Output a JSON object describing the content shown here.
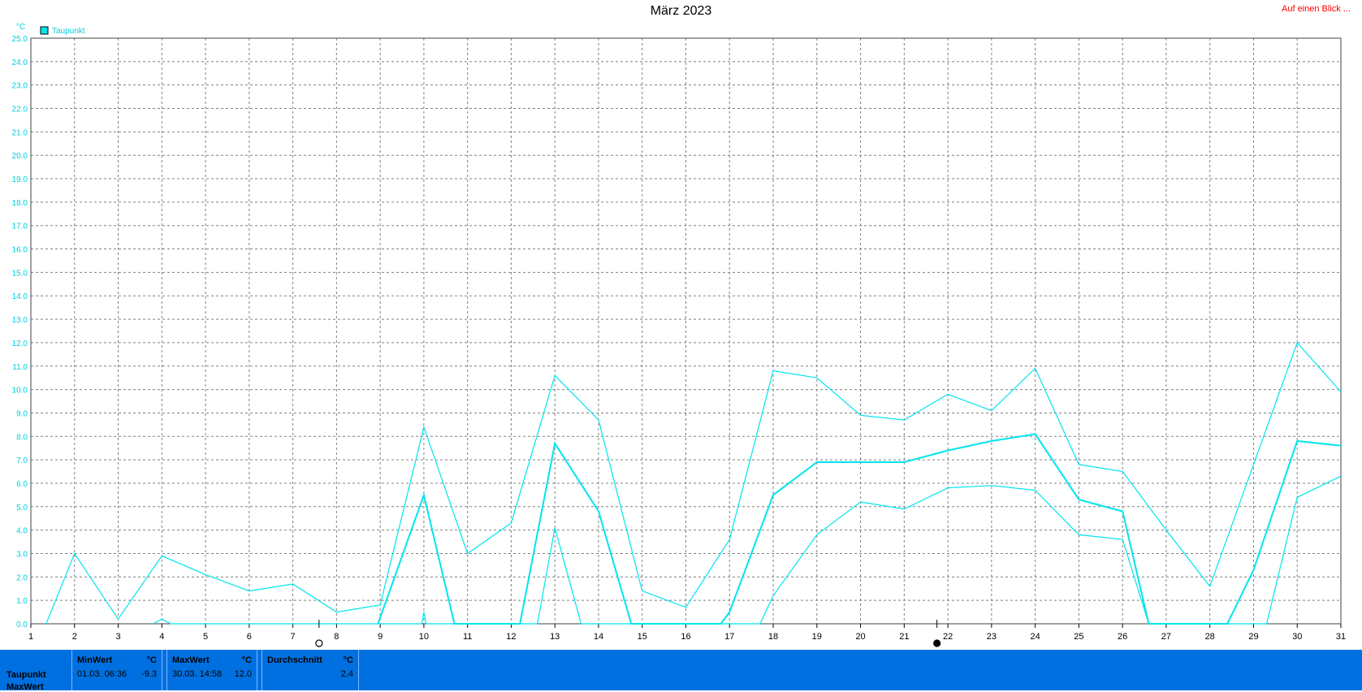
{
  "title": "März 2023",
  "top_link": "Auf einen Blick ...",
  "chart_data": {
    "type": "line",
    "title": "März 2023",
    "ylabel": "°C",
    "ylim": [
      0,
      25
    ],
    "yticks": [
      "0.0",
      "1.0",
      "2.0",
      "3.0",
      "4.0",
      "5.0",
      "6.0",
      "7.0",
      "8.0",
      "9.0",
      "10.0",
      "11.0",
      "12.0",
      "13.0",
      "14.0",
      "15.0",
      "16.0",
      "17.0",
      "18.0",
      "19.0",
      "20.0",
      "21.0",
      "22.0",
      "23.0",
      "24.0",
      "25.0"
    ],
    "xlim": [
      1,
      31
    ],
    "xticks": [
      "1",
      "2",
      "3",
      "4",
      "5",
      "6",
      "7",
      "8",
      "9",
      "10",
      "11",
      "12",
      "13",
      "14",
      "15",
      "16",
      "17",
      "18",
      "19",
      "20",
      "21",
      "22",
      "23",
      "24",
      "25",
      "26",
      "27",
      "28",
      "29",
      "30",
      "31"
    ],
    "grid": true,
    "legend": [
      "Taupunkt"
    ],
    "legend_position": "top-left",
    "color": "#00e5ee",
    "series": [
      {
        "name": "Taupunkt",
        "role": "max",
        "x": [
          1.35,
          2,
          3,
          4,
          5,
          6,
          7,
          8,
          9,
          10,
          11,
          12,
          13,
          14,
          15,
          16,
          17,
          18,
          19,
          20,
          21,
          22,
          23,
          24,
          25,
          26,
          27,
          28,
          29,
          30,
          31
        ],
        "values": [
          0,
          3.0,
          0.2,
          2.9,
          2.1,
          1.4,
          1.7,
          0.5,
          0.8,
          8.4,
          3.0,
          4.3,
          10.6,
          8.7,
          1.4,
          0.7,
          3.6,
          10.8,
          10.5,
          8.9,
          8.7,
          9.8,
          9.1,
          10.9,
          6.8,
          6.5,
          4.0,
          1.6,
          6.8,
          12.0,
          9.9
        ]
      },
      {
        "name": "Taupunkt",
        "role": "avg",
        "x": [
          8.95,
          10,
          10.7,
          12.2,
          13,
          14,
          14.75,
          16.8,
          17,
          18,
          19,
          20,
          21,
          22,
          23,
          24,
          25,
          26,
          26.6,
          28.4,
          29,
          30,
          31
        ],
        "values": [
          0,
          5.5,
          0,
          0,
          7.7,
          4.8,
          0,
          0,
          0.5,
          5.5,
          6.9,
          6.9,
          6.9,
          7.4,
          7.8,
          8.1,
          5.3,
          4.8,
          0,
          0,
          2.3,
          7.8,
          7.6
        ]
      },
      {
        "name": "Taupunkt",
        "role": "min",
        "x": [
          3.8,
          4,
          4.2,
          9.95,
          10,
          10.05,
          12.6,
          13,
          13.6,
          17.7,
          18,
          19,
          20,
          21,
          22,
          23,
          24,
          25,
          26,
          26.6,
          29.3,
          30,
          31
        ],
        "values": [
          0,
          0.2,
          0,
          0,
          0.5,
          0,
          0,
          4.1,
          0,
          0,
          1.2,
          3.8,
          5.2,
          4.9,
          5.8,
          5.9,
          5.7,
          3.8,
          3.6,
          0,
          0,
          5.4,
          6.3
        ]
      }
    ],
    "markers": [
      {
        "symbol": "empty-circle",
        "x": 7.6
      },
      {
        "symbol": "filled-circle",
        "x": 21.75
      }
    ]
  },
  "stats": {
    "row_labels": [
      "Taupunkt",
      "MaxWert"
    ],
    "columns": [
      {
        "header": "MinWert",
        "unit": "°C",
        "date": "01.03.  06:36",
        "value": "-9.3"
      },
      {
        "header": "MaxWert",
        "unit": "°C",
        "date": "30.03.  14:58",
        "value": "12.0"
      },
      {
        "header": "Durchschnitt",
        "unit": "°C",
        "date": "",
        "value": "2.4"
      }
    ]
  }
}
